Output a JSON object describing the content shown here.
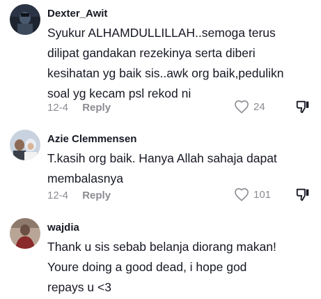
{
  "comments": [
    {
      "username": "Dexter_Awit",
      "lines": [
        "Syukur ALHAMDULLILLAH..semoga terus",
        "dilipat gandakan rezekinya serta diberi",
        "kesihatan yg baik sis..awk org baik,pedulikn",
        "soal yg kecam psl rekod ni"
      ],
      "date": "12-4",
      "reply_label": "Reply",
      "likes": "24",
      "avatar_icon": "profile-photo-icon"
    },
    {
      "username": "Azie Clemmensen",
      "lines": [
        "T.kasih org baik. Hanya Allah sahaja dapat",
        "membalasnya"
      ],
      "date": "12-4",
      "reply_label": "Reply",
      "likes": "101",
      "avatar_icon": "profile-photo-icon"
    },
    {
      "username": "wajdia",
      "lines": [
        "Thank u sis sebab belanja diorang makan!",
        "Youre doing a good dead, i hope god",
        "repays u <3"
      ],
      "avatar_icon": "profile-photo-icon"
    }
  ],
  "colors": {
    "text": "#161823",
    "muted": "#8a8b91",
    "background": "#ffffff"
  }
}
